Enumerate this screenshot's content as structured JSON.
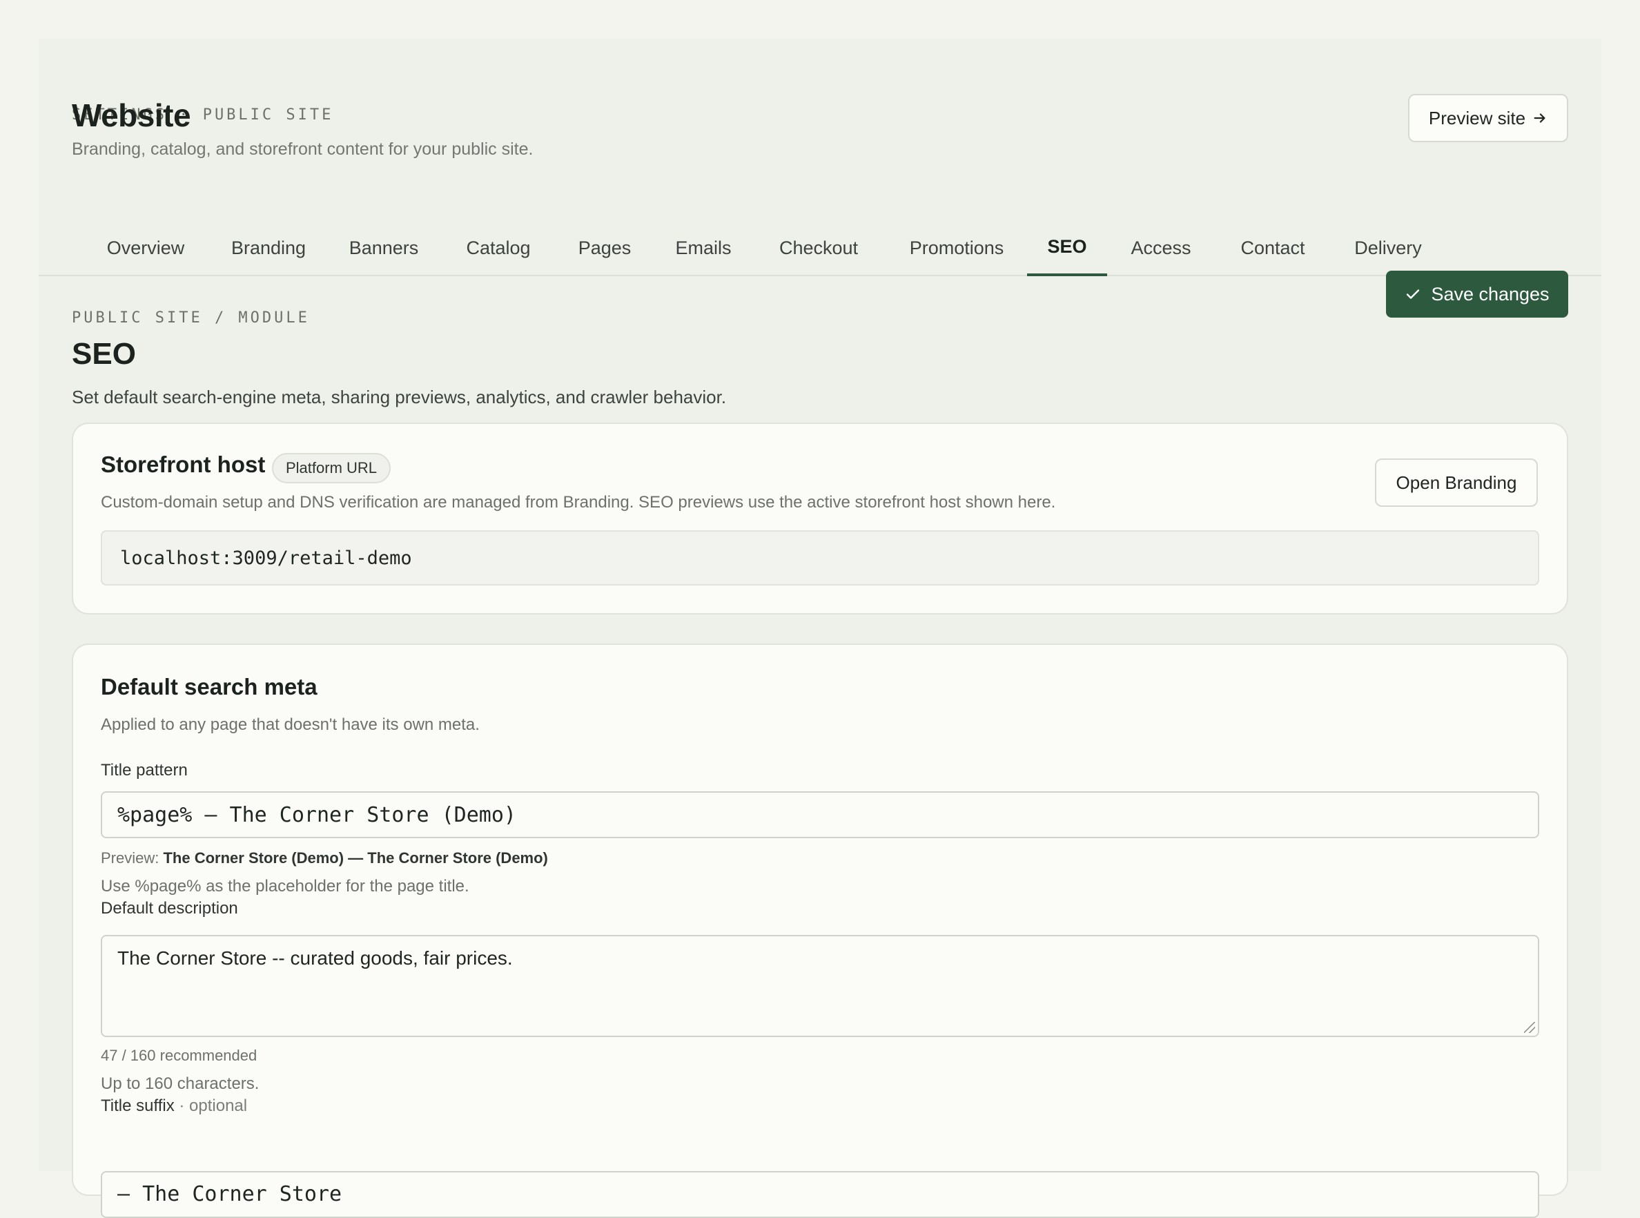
{
  "header": {
    "breadcrumb": "SETTINGS · PUBLIC SITE",
    "title": "Website",
    "subtitle": "Branding, catalog, and storefront content for your public site.",
    "preview_label": "Preview site",
    "preview_icon": "arrow-right-icon"
  },
  "tabs": [
    {
      "label": "Overview"
    },
    {
      "label": "Branding"
    },
    {
      "label": "Banners"
    },
    {
      "label": "Catalog"
    },
    {
      "label": "Pages"
    },
    {
      "label": "Emails"
    },
    {
      "label": "Checkout"
    },
    {
      "label": "Promotions"
    },
    {
      "label": "SEO",
      "active": true
    },
    {
      "label": "Access"
    },
    {
      "label": "Contact"
    },
    {
      "label": "Delivery"
    }
  ],
  "module": {
    "breadcrumb": "PUBLIC SITE / MODULE",
    "title": "SEO",
    "description": "Set default search-engine meta, sharing previews, analytics, and crawler behavior.",
    "save_label": "Save changes"
  },
  "storefront_host": {
    "title": "Storefront host",
    "badge": "Platform URL",
    "help": "Custom-domain setup and DNS verification are managed from Branding. SEO previews use the active storefront host shown here.",
    "open_label": "Open Branding",
    "host_value": "localhost:3009/retail-demo"
  },
  "search_meta": {
    "title": "Default search meta",
    "help": "Applied to any page that doesn't have its own meta.",
    "title_pattern_label": "Title pattern",
    "title_pattern_value": "%page% — The Corner Store (Demo)",
    "preview_prefix": "Preview:",
    "preview_value": "The Corner Store (Demo) — The Corner Store (Demo)",
    "title_pattern_note": "Use %page% as the placeholder for the page title.",
    "description_label": "Default description",
    "description_value": "The Corner Store -- curated goods, fair prices.",
    "description_count": "47 / 160 recommended",
    "description_note": "Up to 160 characters.",
    "suffix_label": "Title suffix",
    "suffix_optional": "· optional",
    "suffix_value": "— The Corner Store"
  },
  "colors": {
    "accent": "#2d5a3e",
    "background": "#eef0ea",
    "card": "#fbfbf8"
  }
}
